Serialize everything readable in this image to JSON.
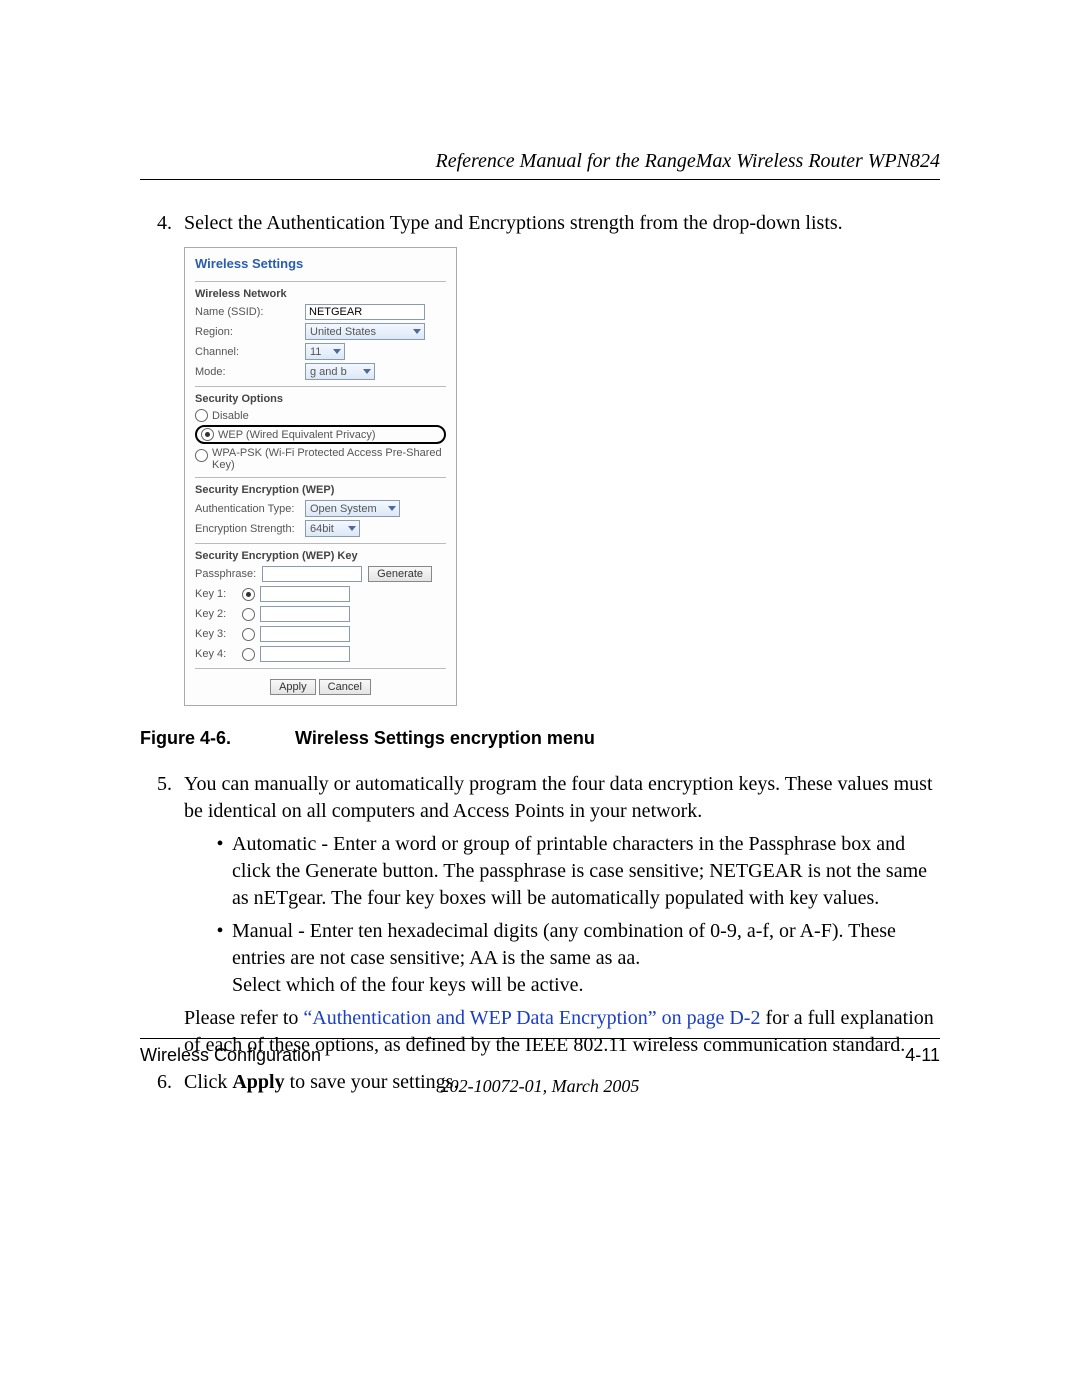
{
  "header": {
    "title": "Reference Manual for the RangeMax Wireless Router WPN824"
  },
  "steps": {
    "s4": {
      "num": "4.",
      "text": "Select the Authentication Type and Encryptions strength from the drop-down lists."
    },
    "s5": {
      "num": "5.",
      "text": "You can manually or automatically program the four data encryption keys. These values must be identical on all computers and Access Points in your network.",
      "bullets": {
        "b1": "Automatic - Enter a word or group of printable characters in the Passphrase box and click the Generate button. The passphrase is case sensitive; NETGEAR is not the same as nETgear. The four key boxes will be automatically populated with key values.",
        "b2a": "Manual - Enter ten hexadecimal digits (any combination of 0-9, a-f, or A-F). These entries are not case sensitive; AA is the same as aa.",
        "b2b": "Select which of the four keys will be active."
      },
      "ref_pre": "Please refer to ",
      "ref_link": "“Authentication and WEP Data Encryption” on page D-2",
      "ref_post": " for a full explanation of each of these options, as defined by the IEEE 802.11 wireless communication standard."
    },
    "s6": {
      "num": "6.",
      "pre": "Click ",
      "bold": "Apply",
      "post": " to save your settings."
    }
  },
  "figure": {
    "label": "Figure 4-6.",
    "caption": "Wireless Settings encryption menu"
  },
  "panel": {
    "title": "Wireless Settings",
    "network": {
      "heading": "Wireless Network",
      "ssid_label": "Name (SSID):",
      "ssid_value": "NETGEAR",
      "region_label": "Region:",
      "region_value": "United States",
      "channel_label": "Channel:",
      "channel_value": "11",
      "mode_label": "Mode:",
      "mode_value": "g and b"
    },
    "security": {
      "heading": "Security Options",
      "opt_disable": "Disable",
      "opt_wep": "WEP (Wired Equivalent Privacy)",
      "opt_wpa": "WPA-PSK (Wi-Fi Protected Access Pre-Shared Key)"
    },
    "enc": {
      "heading": "Security Encryption (WEP)",
      "auth_label": "Authentication Type:",
      "auth_value": "Open System",
      "strength_label": "Encryption Strength:",
      "strength_value": "64bit"
    },
    "keys": {
      "heading": "Security Encryption (WEP) Key",
      "pass_label": "Passphrase:",
      "generate": "Generate",
      "k1": "Key 1:",
      "k2": "Key 2:",
      "k3": "Key 3:",
      "k4": "Key 4:"
    },
    "buttons": {
      "apply": "Apply",
      "cancel": "Cancel"
    }
  },
  "footer": {
    "left": "Wireless Configuration",
    "right": "4-11",
    "docid": "202-10072-01, March 2005"
  }
}
